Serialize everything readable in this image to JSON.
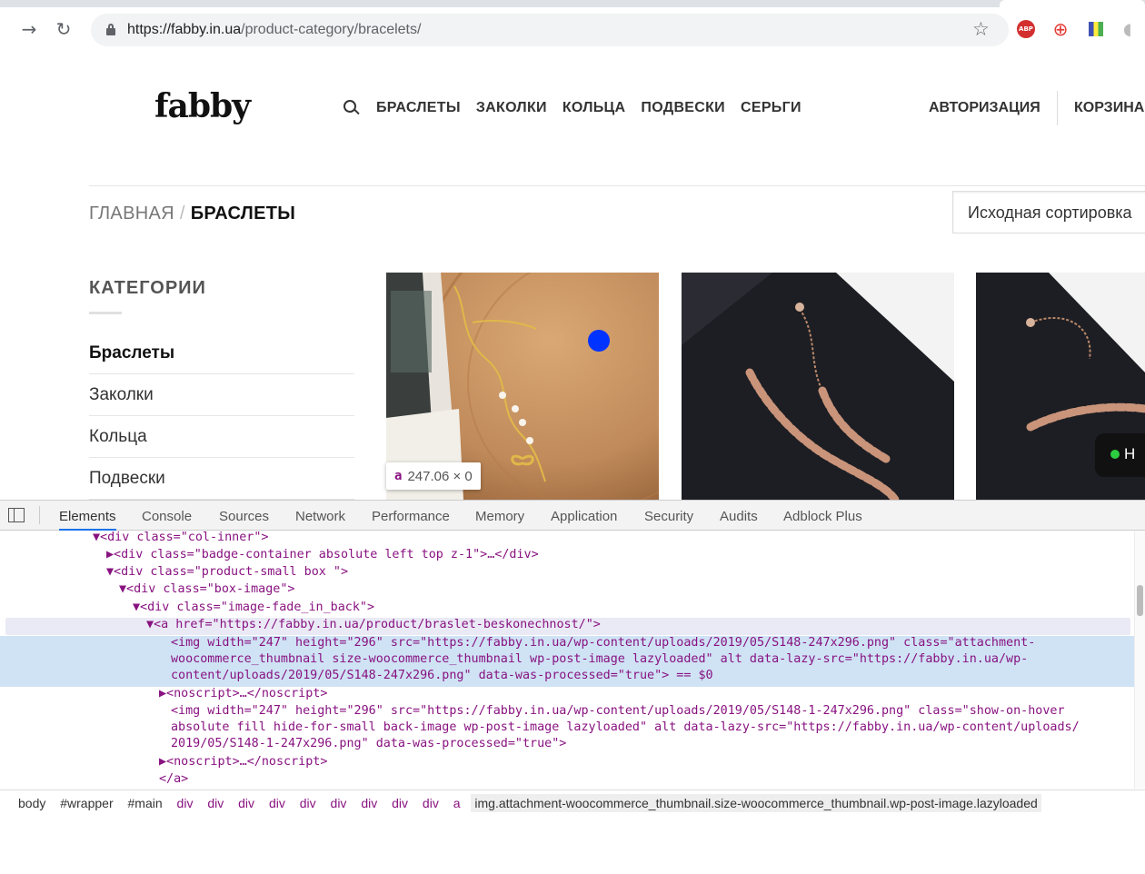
{
  "browser": {
    "url_host": "https://fabby.in.ua",
    "url_path": "/product-category/bracelets/",
    "ext_abp": "ABP"
  },
  "site": {
    "logo": "fabby",
    "nav": [
      "БРАСЛЕТЫ",
      "ЗАКОЛКИ",
      "КОЛЬЦА",
      "ПОДВЕСКИ",
      "СЕРЬГИ"
    ],
    "account": "АВТОРИЗАЦИЯ",
    "cart": "КОРЗИНА",
    "breadcrumb_home": "ГЛАВНАЯ",
    "breadcrumb_sep": "/",
    "breadcrumb_current": "БРАСЛЕТЫ",
    "sort": "Исходная сортировка",
    "categories_title": "КАТЕГОРИИ",
    "categories": [
      "Браслеты",
      "Заколки",
      "Кольца",
      "Подвески"
    ],
    "chat_label": "H"
  },
  "inspect_tooltip": {
    "tag": "a",
    "dims": "247.06 × 0"
  },
  "devtools": {
    "tabs": [
      "Elements",
      "Console",
      "Sources",
      "Network",
      "Performance",
      "Memory",
      "Application",
      "Security",
      "Audits",
      "Adblock Plus"
    ],
    "active_tab": "Elements",
    "lines": [
      "▼<div class=\"col-inner\">",
      "▶<div class=\"badge-container absolute left top z-1\">…</div>",
      "▼<div class=\"product-small box \">",
      "▼<div class=\"box-image\">",
      "▼<div class=\"image-fade_in_back\">",
      "▼<a href=\"https://fabby.in.ua/product/braslet-beskonechnost/\">",
      "<img width=\"247\" height=\"296\" src=\"https://fabby.in.ua/wp-content/uploads/2019/05/S148-247x296.png\" class=\"attachment-",
      "woocommerce_thumbnail size-woocommerce_thumbnail wp-post-image lazyloaded\" alt data-lazy-src=\"https://fabby.in.ua/wp-",
      "content/uploads/2019/05/S148-247x296.png\" data-was-processed=\"true\"> == $0",
      "▶<noscript>…</noscript>",
      "<img width=\"247\" height=\"296\" src=\"https://fabby.in.ua/wp-content/uploads/2019/05/S148-1-247x296.png\" class=\"show-on-hover",
      "absolute fill hide-for-small back-image wp-post-image lazyloaded\" alt data-lazy-src=\"https://fabby.in.ua/wp-content/uploads/",
      "2019/05/S148-1-247x296.png\" data-was-processed=\"true\">",
      "▶<noscript>…</noscript>",
      "</a>"
    ],
    "breadcrumb": [
      "body",
      "#wrapper",
      "#main",
      "div",
      "div",
      "div",
      "div",
      "div",
      "div",
      "div",
      "div",
      "div",
      "a",
      "img.attachment-woocommerce_thumbnail.size-woocommerce_thumbnail.wp-post-image.lazyloaded"
    ]
  }
}
